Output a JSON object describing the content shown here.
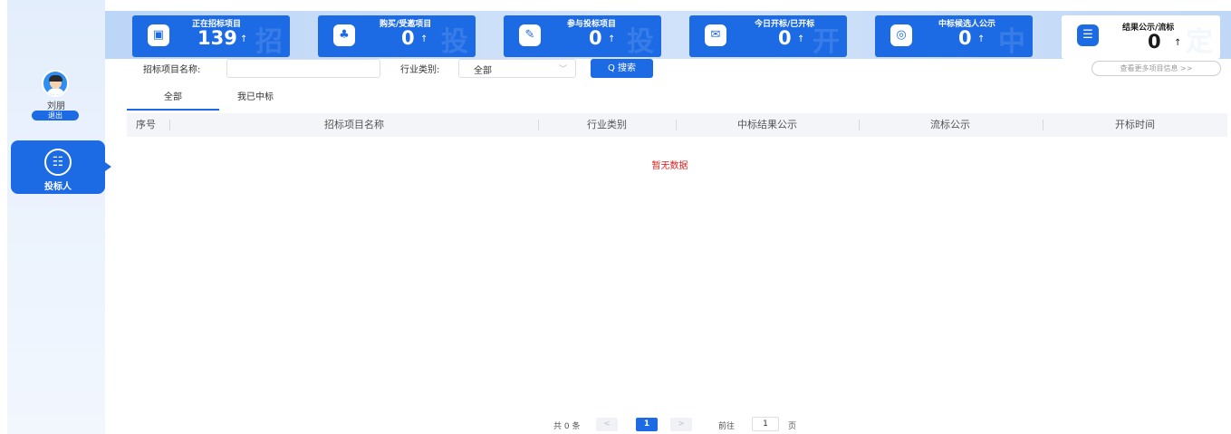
{
  "user": {
    "name": "刘朋",
    "logout_label": "退出"
  },
  "side_menu": {
    "label": "投标人",
    "icon": "bidder-doc-icon"
  },
  "stat_cards": [
    {
      "title": "正在招标项目",
      "value": "139",
      "arrow": "↑",
      "watermark": "招",
      "icon": "tender-doc-icon",
      "glyph": "▣"
    },
    {
      "title": "购买/受邀项目",
      "value": "0",
      "arrow": "↑",
      "watermark": "投",
      "icon": "user-invite-icon",
      "glyph": "♣"
    },
    {
      "title": "参与投标项目",
      "value": "0",
      "arrow": "↑",
      "watermark": "投",
      "icon": "pen-doc-icon",
      "glyph": "✎"
    },
    {
      "title": "今日开标/已开标",
      "value": "0",
      "arrow": "↑",
      "watermark": "开",
      "icon": "mail-open-icon",
      "glyph": "✉"
    },
    {
      "title": "中标候选人公示",
      "value": "0",
      "arrow": "↑",
      "watermark": "中",
      "icon": "target-icon",
      "glyph": "◎"
    },
    {
      "title": "结果公示/流标",
      "value": "0",
      "arrow": "↑",
      "watermark": "定",
      "icon": "result-list-icon",
      "glyph": "☰"
    }
  ],
  "search": {
    "name_label": "招标项目名称:",
    "name_value": "",
    "industry_label": "行业类别:",
    "industry_value": "全部",
    "search_button": "Q 搜索",
    "more_button": "查看更多项目信息 >>"
  },
  "tabs": [
    {
      "label": "全部",
      "active": true
    },
    {
      "label": "我已中标",
      "active": false
    }
  ],
  "table": {
    "columns": [
      "序号",
      "招标项目名称",
      "行业类别",
      "中标结果公示",
      "流标公示",
      "开标时间"
    ],
    "rows": [],
    "empty_text": "暂无数据"
  },
  "pagination": {
    "total_text": "共 0 条",
    "prev": "<",
    "current_page": "1",
    "next": ">",
    "goto_label": "前往",
    "goto_value": "1",
    "page_suffix": "页"
  },
  "colors": {
    "primary": "#1d6ae5",
    "empty_text": "#e0201e",
    "banner": "#c7dcf8"
  }
}
